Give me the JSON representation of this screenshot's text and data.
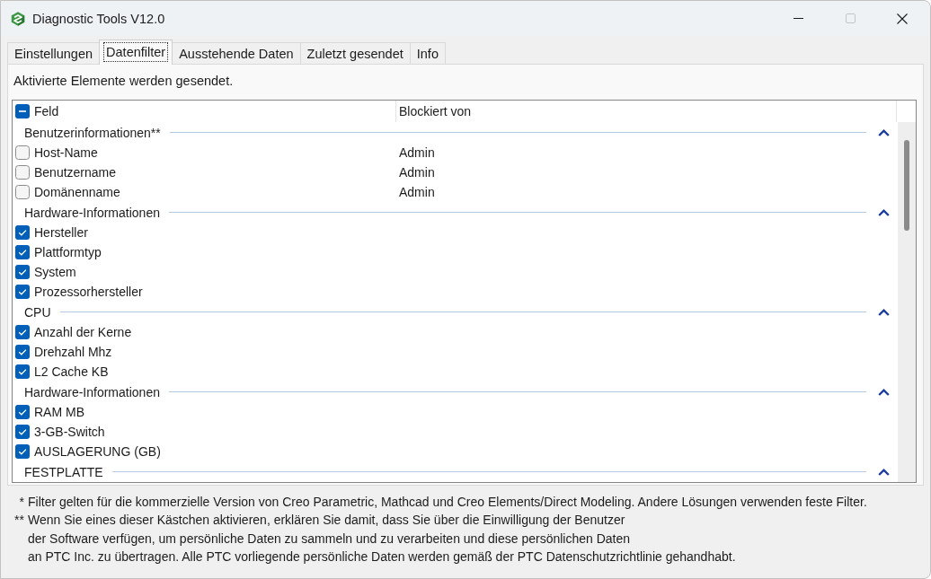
{
  "window": {
    "title": "Diagnostic Tools V12.0",
    "controls": [
      {
        "kind": "minimize",
        "disabled": false
      },
      {
        "kind": "maximize",
        "disabled": true
      },
      {
        "kind": "close",
        "disabled": false
      }
    ]
  },
  "tabs": [
    {
      "label": "Einstellungen",
      "selected": false
    },
    {
      "label": "Datenfilter",
      "selected": true
    },
    {
      "label": "Ausstehende Daten",
      "selected": false
    },
    {
      "label": "Zuletzt gesendet",
      "selected": false
    },
    {
      "label": "Info",
      "selected": false
    }
  ],
  "description": "Aktivierte Elemente werden gesendet.",
  "table": {
    "select_all": {
      "checked": true,
      "mixed": true
    },
    "columns": [
      "Feld",
      "Blockiert von"
    ],
    "groups": [
      {
        "title": "Benutzerinformationen**",
        "expanded": true,
        "rows": [
          {
            "field": "Host-Name",
            "blocked_by": "Admin",
            "checked": false
          },
          {
            "field": "Benutzername",
            "blocked_by": "Admin",
            "checked": false
          },
          {
            "field": "Domänenname",
            "blocked_by": "Admin",
            "checked": false
          }
        ]
      },
      {
        "title": "Hardware-Informationen",
        "expanded": true,
        "rows": [
          {
            "field": "Hersteller",
            "checked": true
          },
          {
            "field": "Plattformtyp",
            "checked": true
          },
          {
            "field": "System",
            "checked": true
          },
          {
            "field": "Prozessorhersteller",
            "checked": true
          }
        ]
      },
      {
        "title": "CPU",
        "expanded": true,
        "rows": [
          {
            "field": "Anzahl der Kerne",
            "checked": true
          },
          {
            "field": "Drehzahl Mhz",
            "checked": true
          },
          {
            "field": "L2 Cache KB",
            "checked": true
          }
        ]
      },
      {
        "title": "Hardware-Informationen",
        "expanded": true,
        "rows": [
          {
            "field": "RAM MB",
            "checked": true
          },
          {
            "field": "3-GB-Switch",
            "checked": true
          },
          {
            "field": "AUSLAGERUNG (GB)",
            "checked": true
          }
        ]
      },
      {
        "title": "FESTPLATTE",
        "expanded": true
      }
    ]
  },
  "footnotes": [
    {
      "marker": "*",
      "lines": [
        "Filter gelten für die kommerzielle Version von Creo Parametric, Mathcad und Creo Elements/Direct Modeling. Andere Lösungen verwenden feste Filter."
      ]
    },
    {
      "marker": "**",
      "lines": [
        "Wenn Sie eines dieser Kästchen aktivieren, erklären Sie damit, dass Sie über die Einwilligung der Benutzer",
        "der Software verfügen, um persönliche Daten zu sammeln und zu verarbeiten und diese persönlichen Daten",
        "an PTC Inc. zu übertragen. Alle PTC vorliegende persönliche Daten werden gemäß der PTC Datenschutzrichtlinie gehandhabt."
      ]
    }
  ]
}
